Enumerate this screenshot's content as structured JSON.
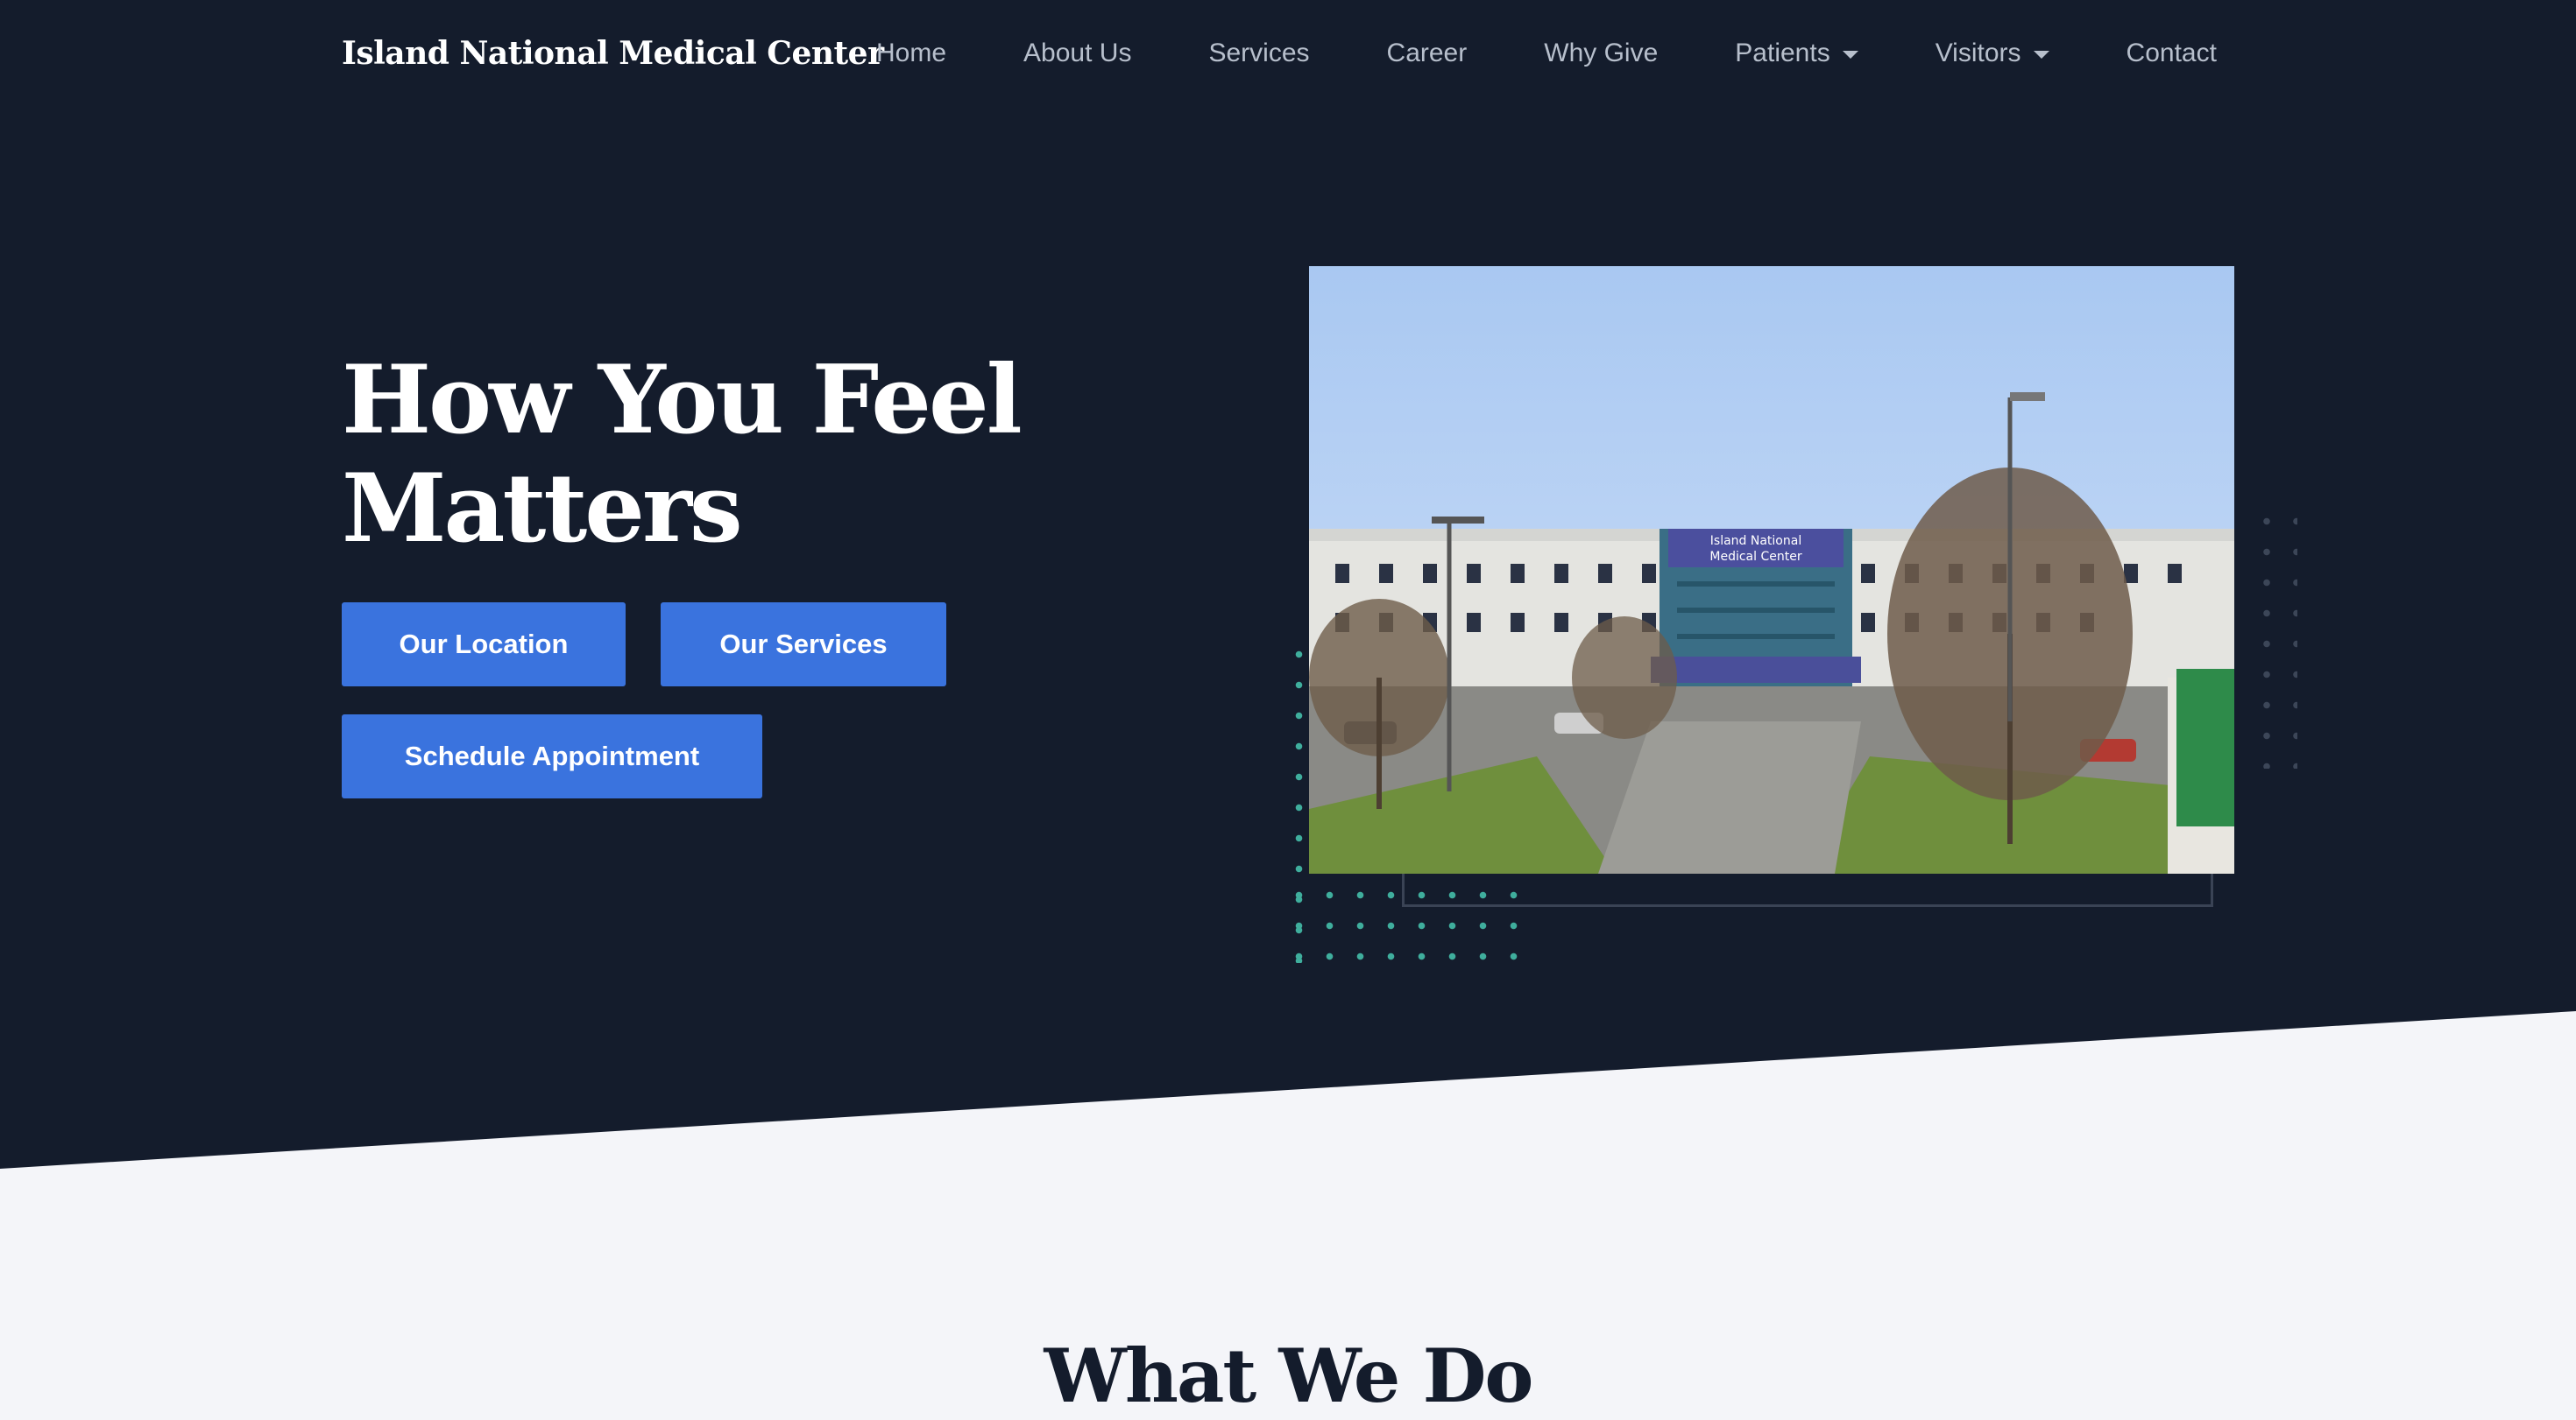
{
  "header": {
    "brand": "Island National Medical Center"
  },
  "nav": {
    "items": [
      {
        "label": "Home",
        "dropdown": false
      },
      {
        "label": "About Us",
        "dropdown": false
      },
      {
        "label": "Services",
        "dropdown": false
      },
      {
        "label": "Career",
        "dropdown": false
      },
      {
        "label": "Why Give",
        "dropdown": false
      },
      {
        "label": "Patients",
        "dropdown": true
      },
      {
        "label": "Visitors",
        "dropdown": true
      },
      {
        "label": "Contact",
        "dropdown": false
      }
    ]
  },
  "hero": {
    "title_line1": "How You Feel",
    "title_line2": "Matters",
    "buttons": {
      "location": "Our Location",
      "services": "Our Services",
      "appointment": "Schedule Appointment"
    },
    "image": {
      "sign_line1": "Island National",
      "sign_line2": "Medical Center"
    }
  },
  "section": {
    "title": "What We Do"
  },
  "colors": {
    "hero_background": "#141c2c",
    "page_background": "#f4f5f9",
    "button": "#3a73de",
    "accent_dots": "#3fae9d"
  }
}
